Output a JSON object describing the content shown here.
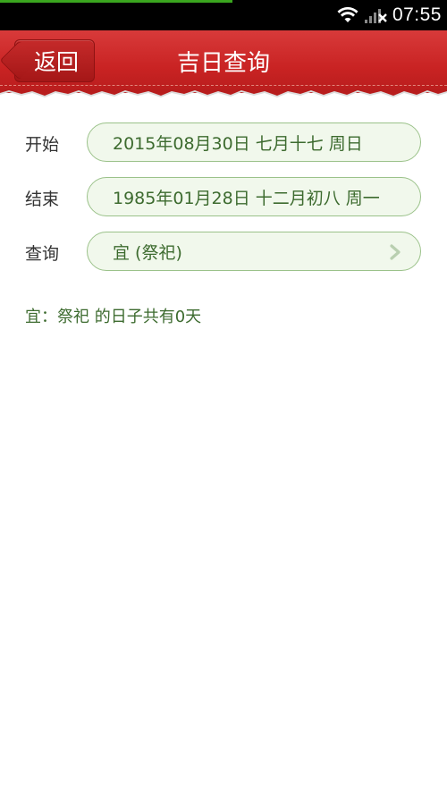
{
  "status_bar": {
    "time": "07:55",
    "icons": [
      "wifi-icon",
      "signal-icon"
    ]
  },
  "header": {
    "back_label": "返回",
    "title": "吉日查询"
  },
  "form": {
    "start": {
      "label": "开始",
      "value": "2015年08月30日 七月十七 周日"
    },
    "end": {
      "label": "结束",
      "value": "1985年01月28日 十二月初八 周一"
    },
    "query": {
      "label": "查询",
      "value": "宜 (祭祀)",
      "icon": "chevron-right-icon"
    }
  },
  "result": "宜：祭祀 的日子共有0天",
  "colors": {
    "header": "#c92323",
    "field_bg": "#f1f8ec",
    "field_border": "#9bc28a",
    "field_text": "#3d6b2f"
  }
}
